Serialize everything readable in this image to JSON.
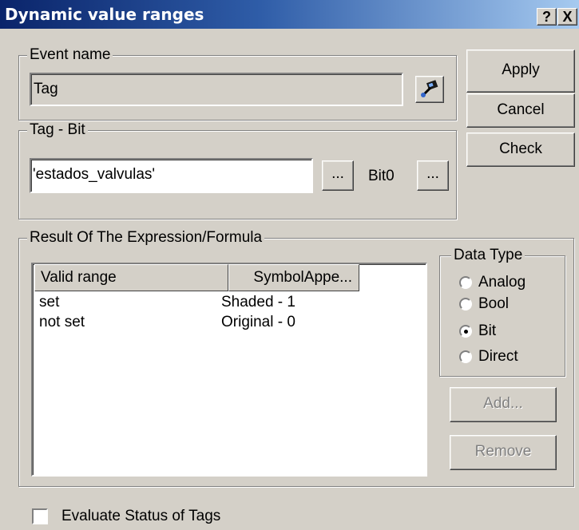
{
  "window": {
    "title": "Dynamic value ranges",
    "help_label": "?",
    "close_label": "X"
  },
  "event_name": {
    "legend": "Event name",
    "value": "Tag",
    "picker_icon": "tag-picker-icon"
  },
  "tag_bit": {
    "legend": "Tag - Bit",
    "tag_value": "'estados_valvulas'",
    "tag_browse_label": "...",
    "bit_label": "Bit0",
    "bit_browse_label": "..."
  },
  "buttons": {
    "apply": "Apply",
    "cancel": "Cancel",
    "check": "Check",
    "add": "Add...",
    "remove": "Remove"
  },
  "result": {
    "legend": "Result Of The Expression/Formula",
    "columns": [
      "Valid range",
      "SymbolAppe..."
    ],
    "rows": [
      {
        "range": "set",
        "symbol": "Shaded - 1"
      },
      {
        "range": "not set",
        "symbol": "Original - 0"
      }
    ]
  },
  "data_type": {
    "legend": "Data Type",
    "options": [
      "Analog",
      "Bool",
      "Bit",
      "Direct"
    ],
    "selected": "Bit"
  },
  "evaluate_status": {
    "label": "Evaluate Status of Tags",
    "checked": false
  }
}
